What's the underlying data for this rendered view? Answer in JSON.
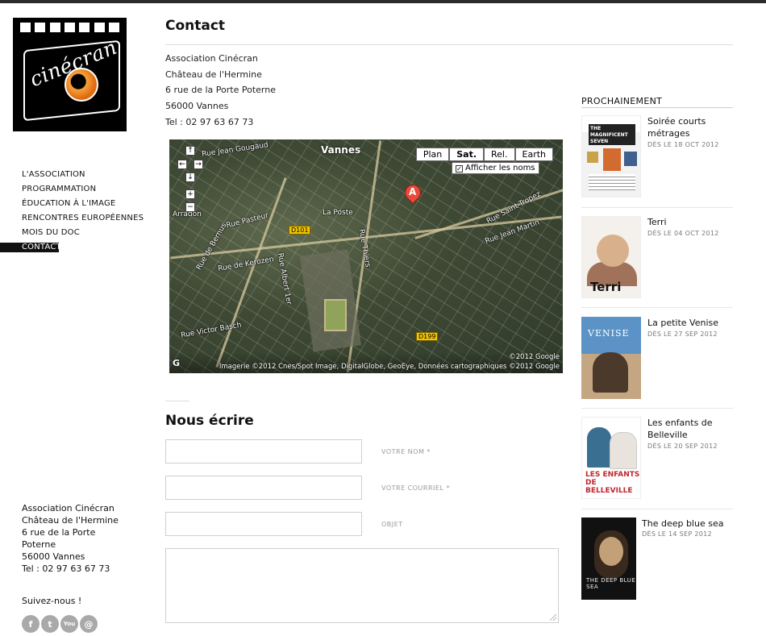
{
  "logo": {
    "text": "cinécran"
  },
  "nav": {
    "items": [
      {
        "label": "L'ASSOCIATION"
      },
      {
        "label": "PROGRAMMATION"
      },
      {
        "label": "ÉDUCATION À L'IMAGE"
      },
      {
        "label": "RENCONTRES EUROPÉENNES"
      },
      {
        "label": "MOIS DU DOC"
      },
      {
        "label": "CONTACT",
        "active": true
      }
    ]
  },
  "sidebar_address": {
    "lines": [
      "Association Cinécran",
      "Château de l'Hermine",
      "6 rue de la Porte",
      "Poterne",
      "56000 Vannes",
      "Tel : 02 97 63 67 73"
    ]
  },
  "follow": {
    "label": "Suivez-nous !",
    "icons": [
      "facebook-icon",
      "twitter-icon",
      "youtube-icon",
      "email-icon"
    ],
    "glyphs": [
      "f",
      "t",
      "You",
      "@"
    ]
  },
  "main": {
    "title": "Contact",
    "address": [
      "Association Cinécran",
      "Château de l'Hermine",
      "6 rue de la Porte Poterne",
      "56000 Vannes",
      "Tel : 02 97 63 67 73"
    ]
  },
  "map": {
    "city": "Vannes",
    "types": [
      "Plan",
      "Sat.",
      "Rel.",
      "Earth"
    ],
    "selected_type": "Sat.",
    "labels_checkbox": "Afficher les noms",
    "marker": "A",
    "street_labels": [
      "Rue Jean Gougaud",
      "Rue Pasteur",
      "Rue de Kerozen",
      "Rue Victor Basch",
      "Rue Albert 1er",
      "Rue Thiers",
      "Rue Jean Martin",
      "Rue Saint-Tropez",
      "Rue de Bernus",
      "Arradon",
      "La Poste"
    ],
    "road_shields": [
      "D101",
      "D199"
    ],
    "copyright": "©2012 Google",
    "attribution": "Imagerie ©2012 Cnes/Spot Image, DigitalGlobe, GeoEye, Données cartographiques ©2012 Google",
    "pan_buttons": [
      "↑",
      "←",
      "→",
      "↓",
      "+",
      "−"
    ]
  },
  "form": {
    "title": "Nous écrire",
    "name_label": "VOTRE NOM *",
    "email_label": "VOTRE COURRIEL *",
    "subject_label": "OBJET"
  },
  "upcoming": {
    "heading": "PROCHAINEMENT",
    "films": [
      {
        "title": "Soirée courts métrages",
        "date": "DÈS LE 18 OCT 2012",
        "poster_text": "THE MAGNIFICENT SEVEN"
      },
      {
        "title": "Terri",
        "date": "DÈS LE 04 OCT 2012",
        "poster_text": "Terri"
      },
      {
        "title": "La petite Venise",
        "date": "DÈS LE 27 SEP 2012",
        "poster_text": "VENISE"
      },
      {
        "title": "Les enfants de Belleville",
        "date": "DÈS LE 20 SEP 2012",
        "poster_text": "LES ENFANTS DE BELLEVILLE"
      },
      {
        "title": "The deep blue sea",
        "date": "DÈS LE 14 SEP 2012",
        "poster_text": "THE DEEP BLUE SEA"
      }
    ]
  }
}
